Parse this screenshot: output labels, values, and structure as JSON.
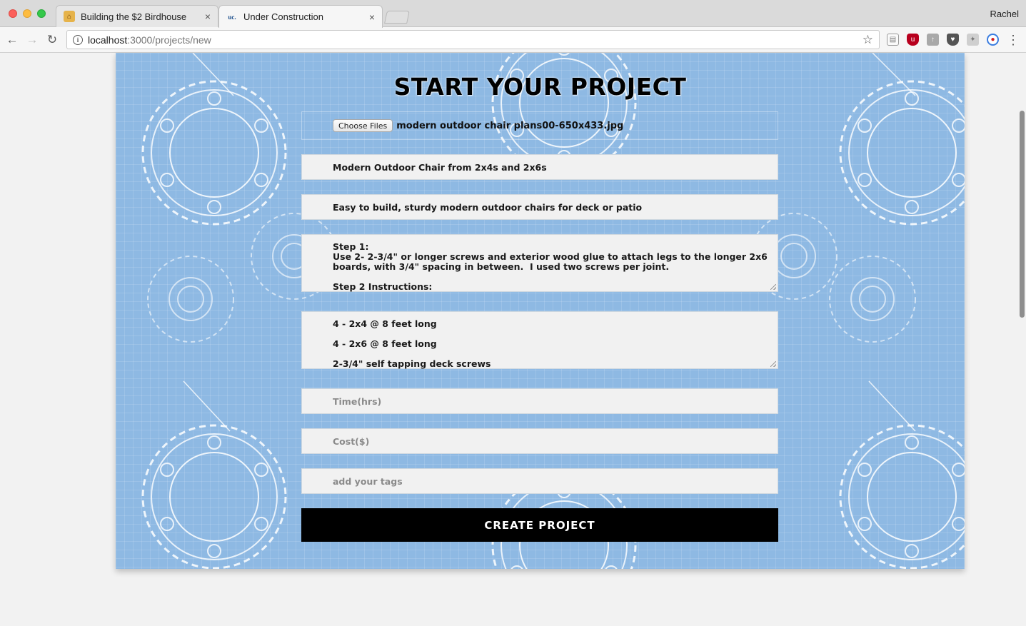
{
  "browser": {
    "tabs": [
      {
        "title": "Building the $2 Birdhouse",
        "favicon": "birdhouse-favicon",
        "active": false
      },
      {
        "title": "Under Construction",
        "favicon": "uc-favicon",
        "active": true
      }
    ],
    "close_glyph": "×",
    "profile_name": "Rachel",
    "url_host": "localhost",
    "url_path": ":3000/projects/new",
    "nav": {
      "back": "←",
      "forward": "→",
      "reload": "↻",
      "star": "☆",
      "menu": "⋮",
      "info": "i"
    },
    "uc_favicon_text": "uc.",
    "extensions": [
      "screenshot-extension-icon",
      "ublock-icon",
      "extension-icon",
      "shield-extension-icon",
      "puzzle-extension-icon",
      "sync-extension-icon"
    ]
  },
  "page": {
    "title": "START YOUR PROJECT",
    "file_input": {
      "button_label": "Choose Files",
      "file_name": "modern outdoor chair plans00-650x433.jpg"
    },
    "fields": {
      "title_value": "Modern Outdoor Chair from 2x4s and 2x6s",
      "description_value": "Easy to build, sturdy modern outdoor chairs for deck or patio",
      "steps_value": "Step 1:\nUse 2- 2-3/4\" or longer screws and exterior wood glue to attach legs to the longer 2x6\nboards, with 3/4\" spacing in between.  I used two screws per joint.\n\nStep 2 Instructions:",
      "materials_value": "4 - 2x4 @ 8 feet long\n\n4 - 2x6 @ 8 feet long\n\n2-3/4\" self tapping deck screws",
      "time_placeholder": "Time(hrs)",
      "cost_placeholder": "Cost($)",
      "tags_placeholder": "add your tags"
    },
    "submit_label": "CREATE PROJECT"
  },
  "colors": {
    "background_blue": "#8eb9e3",
    "button_black": "#000000",
    "field_gray": "#f1f1f1"
  }
}
